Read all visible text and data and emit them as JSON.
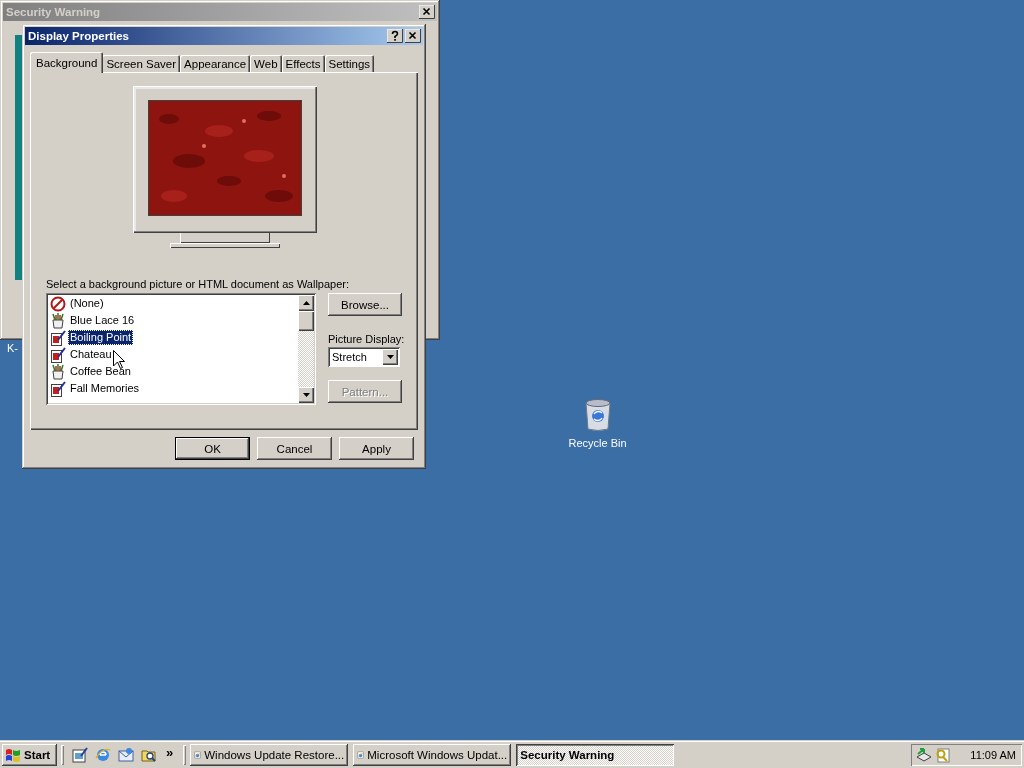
{
  "desktop": {
    "icons": [
      {
        "label": "Recycle Bin",
        "kind": "recycle-bin"
      }
    ],
    "cut_label": "K-"
  },
  "background_window": {
    "title": "Security Warning",
    "active": false
  },
  "dialog": {
    "title": "Display Properties",
    "active": true,
    "tabs": [
      {
        "label": "Background",
        "selected": true
      },
      {
        "label": "Screen Saver",
        "selected": false
      },
      {
        "label": "Appearance",
        "selected": false
      },
      {
        "label": "Web",
        "selected": false
      },
      {
        "label": "Effects",
        "selected": false
      },
      {
        "label": "Settings",
        "selected": false
      }
    ],
    "wallpaper_label": "Select a background picture or HTML document as Wallpaper:",
    "wallpapers": [
      {
        "name": "(None)",
        "kind": "none",
        "selected": false
      },
      {
        "name": "Blue Lace 16",
        "kind": "paint",
        "selected": false
      },
      {
        "name": "Boiling Point",
        "kind": "document",
        "selected": true
      },
      {
        "name": "Chateau",
        "kind": "document",
        "selected": false
      },
      {
        "name": "Coffee Bean",
        "kind": "paint",
        "selected": false
      },
      {
        "name": "Fall Memories",
        "kind": "document",
        "selected": false
      }
    ],
    "browse_button": {
      "label": "Browse...",
      "disabled": false
    },
    "picture_display_label": "Picture Display:",
    "picture_display": "Stretch",
    "pattern_button": {
      "label": "Pattern...",
      "disabled": true
    },
    "buttons": [
      {
        "label": "OK",
        "default": true
      },
      {
        "label": "Cancel",
        "default": false
      },
      {
        "label": "Apply",
        "default": false
      }
    ]
  },
  "taskbar": {
    "start": "Start",
    "more": "»",
    "tasks": [
      {
        "label": "Windows Update Restore...",
        "active": false
      },
      {
        "label": "Microsoft Windows Updat...",
        "active": false
      },
      {
        "label": "Security Warning",
        "active": true
      }
    ],
    "clock": "11:09 AM"
  }
}
